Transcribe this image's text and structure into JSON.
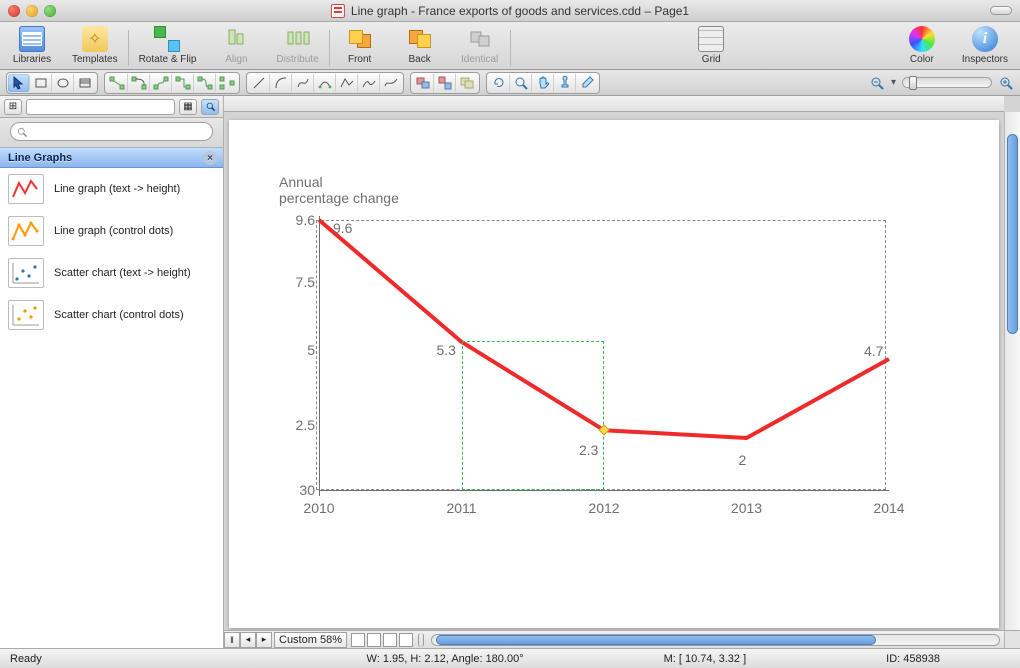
{
  "title": "Line graph - France exports of goods and services.cdd – Page1",
  "toolbar": {
    "libraries": "Libraries",
    "templates": "Templates",
    "rotate_flip": "Rotate & Flip",
    "align": "Align",
    "distribute": "Distribute",
    "front": "Front",
    "back": "Back",
    "identical": "Identical",
    "grid": "Grid",
    "color": "Color",
    "inspectors": "Inspectors"
  },
  "sidebar": {
    "panel_title": "Line Graphs",
    "search_placeholder": "",
    "items": [
      {
        "label": "Line graph (text -> height)"
      },
      {
        "label": "Line graph (control dots)"
      },
      {
        "label": "Scatter chart (text -> height)"
      },
      {
        "label": "Scatter chart (control dots)"
      }
    ]
  },
  "bottombar": {
    "zoom_label": "Custom 58%"
  },
  "statusbar": {
    "status": "Ready",
    "dims": "W: 1.95,  H: 2.12,  Angle: 180.00°",
    "mouse": "M: [ 10.74, 3.32 ]",
    "id": "ID: 458938"
  },
  "chart_data": {
    "type": "line",
    "title": "Annual\npercentage change",
    "xlabel": "",
    "ylabel": "",
    "ylim": [
      30,
      9.6
    ],
    "y_ticks": [
      9.6,
      7.5,
      5,
      2.5,
      30
    ],
    "categories": [
      "2010",
      "2011",
      "2012",
      "2013",
      "2014"
    ],
    "values": [
      9.6,
      5.3,
      2.3,
      2.0,
      4.7
    ],
    "series_color": "#ef2a2a",
    "data_labels": [
      9.6,
      5.3,
      2.3,
      2.0,
      4.7
    ],
    "selected_index": 2
  }
}
